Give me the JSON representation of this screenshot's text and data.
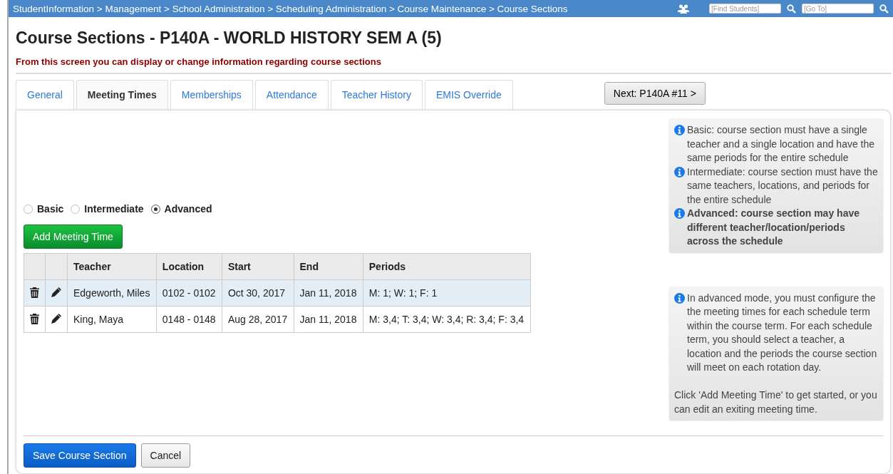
{
  "breadcrumb": "StudentInformation > Management > School Administration > Scheduling Administration > Course Maintenance > Course Sections",
  "top_search": [
    {
      "placeholder": "[Find Students]"
    },
    {
      "placeholder": "[Go To]"
    }
  ],
  "title": "Course Sections - P140A - WORLD HISTORY SEM A (5)",
  "subtitle": "From this screen you can display or change information regarding course sections",
  "tabs": [
    {
      "label": "General",
      "selected": false
    },
    {
      "label": "Meeting Times",
      "selected": true
    },
    {
      "label": "Memberships",
      "selected": false
    },
    {
      "label": "Attendance",
      "selected": false
    },
    {
      "label": "Teacher History",
      "selected": false
    },
    {
      "label": "EMIS Override",
      "selected": false
    }
  ],
  "next_button": "Next: P140A #11 >",
  "modes": [
    {
      "label": "Basic",
      "selected": false
    },
    {
      "label": "Intermediate",
      "selected": false
    },
    {
      "label": "Advanced",
      "selected": true
    }
  ],
  "add_button": "Add Meeting Time",
  "table": {
    "columns": [
      "Teacher",
      "Location",
      "Start",
      "End",
      "Periods"
    ],
    "rows": [
      {
        "selected": true,
        "cells": [
          "Edgeworth, Miles",
          "0102 - 0102",
          "Oct 30, 2017",
          "Jan 11, 2018",
          "M: 1; W: 1; F: 1"
        ]
      },
      {
        "selected": false,
        "cells": [
          "King, Maya",
          "0148 - 0148",
          "Aug 28, 2017",
          "Jan 11, 2018",
          "M: 3,4; T: 3,4; W: 3,4; R: 3,4; F: 3,4"
        ]
      }
    ]
  },
  "notes": [
    [
      {
        "icon": true,
        "bold": false,
        "text": "Basic: course section must have a single teacher and a single location and have the same periods for the entire schedule"
      },
      {
        "icon": true,
        "bold": false,
        "text": "Intermediate: course section must have the same teachers, locations, and periods for the entire schedule"
      },
      {
        "icon": true,
        "bold": true,
        "text": "Advanced: course section may have different teacher/location/periods across the schedule"
      }
    ],
    [
      {
        "icon": true,
        "bold": false,
        "text": "In advanced mode, you must configure the the meeting times for each schedule term within the course term. For each schedule term, you should select a teacher, a location and the periods the course section will meet on each rotation day."
      },
      {
        "icon": false,
        "bold": false,
        "text": "Click 'Add Meeting Time' to get started, or you can edit an exiting meeting time."
      }
    ]
  ],
  "footer_buttons": [
    {
      "kind": "primary",
      "label": "Save Course Section"
    },
    {
      "kind": "default",
      "label": "Cancel"
    }
  ]
}
